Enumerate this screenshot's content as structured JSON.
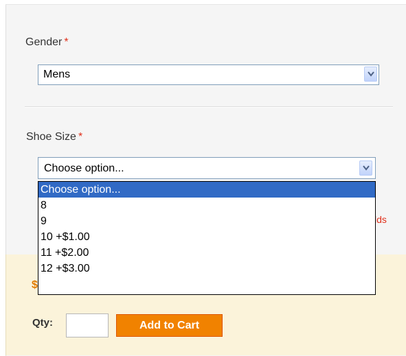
{
  "gender": {
    "label": "Gender",
    "required_mark": "*",
    "selected": "Mens"
  },
  "shoe_size": {
    "label": "Shoe Size",
    "required_mark": "*",
    "selected": "Choose option...",
    "options": [
      "Choose option...",
      "8",
      "9",
      "10 +$1.00",
      "11 +$2.00",
      "12 +$3.00"
    ],
    "highlighted_option": "Choose option..."
  },
  "partially_hidden": {
    "required_fields_peek": "lds",
    "price_peek": "$"
  },
  "cart": {
    "qty_label": "Qty:",
    "qty_value": "",
    "add_button": "Add to Cart"
  },
  "colors": {
    "accent_button": "#f18200",
    "required_star": "#e0311c",
    "highlight": "#316ac5"
  }
}
